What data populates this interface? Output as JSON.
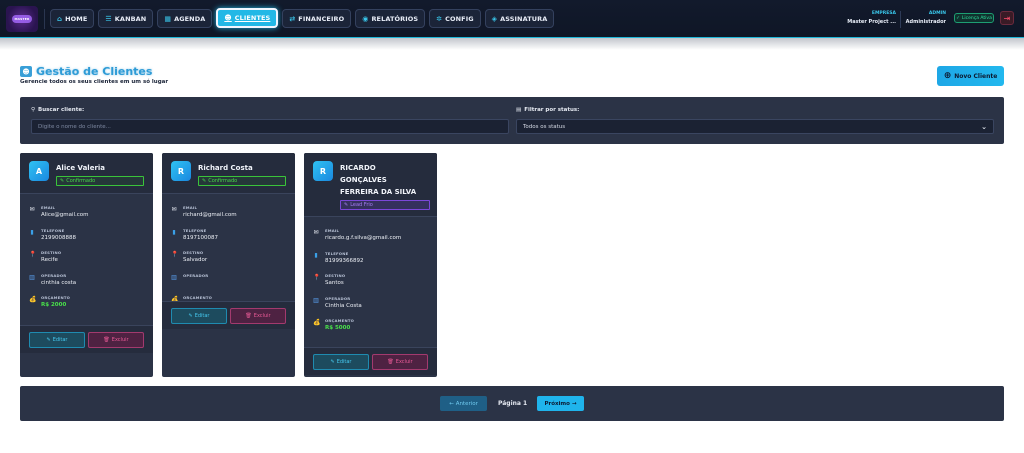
{
  "header": {
    "logo_text": "MASTER",
    "nav": [
      {
        "label": "HOME",
        "icon": "⌂",
        "active": false
      },
      {
        "label": "KANBAN",
        "icon": "☰",
        "active": false
      },
      {
        "label": "AGENDA",
        "icon": "▦",
        "active": false
      },
      {
        "label": "CLIENTES",
        "icon": "☻",
        "active": true
      },
      {
        "label": "FINANCEIRO",
        "icon": "⇄",
        "active": false
      },
      {
        "label": "RELATÓRIOS",
        "icon": "◉",
        "active": false
      },
      {
        "label": "CONFIG",
        "icon": "✲",
        "active": false
      },
      {
        "label": "ASSINATURA",
        "icon": "◈",
        "active": false
      }
    ],
    "empresa_label": "EMPRESA",
    "empresa_value": "Master Project ...",
    "admin_label": "ADMIN",
    "admin_value": "Administrador",
    "licenca_label": "Licença Ativa"
  },
  "page": {
    "title": "Gestão de Clientes",
    "subtitle": "Gerencie todos os seus clientes em um só lugar",
    "new_button": "Novo Cliente"
  },
  "filters": {
    "search_label": "Buscar cliente:",
    "search_placeholder": "Digite o nome do cliente...",
    "status_label": "Filtrar por status:",
    "status_value": "Todos os status"
  },
  "field_labels": {
    "email": "EMAIL",
    "telefone": "TELEFONE",
    "destino": "DESTINO",
    "operador": "OPERADOR",
    "orcamento": "ORÇAMENTO"
  },
  "cards": [
    {
      "initial": "A",
      "name_lines": [
        "Alice Valeria"
      ],
      "status": "Confirmado",
      "status_color": "green",
      "email": "Alice@gmail.com",
      "telefone": "2199008888",
      "destino": "Recife",
      "operador": "cinthia costa",
      "orcamento": "R$ 2000"
    },
    {
      "initial": "R",
      "name_lines": [
        "Richard Costa"
      ],
      "status": "Confirmado",
      "status_color": "green",
      "email": "richard@gmail.com",
      "telefone": "8197100087",
      "destino": "Salvador",
      "operador": "",
      "orcamento": "R$ 3500"
    },
    {
      "initial": "R",
      "name_lines": [
        "RICARDO",
        "GONÇALVES",
        "FERREIRA DA SILVA"
      ],
      "status": "Lead Frio",
      "status_color": "purple",
      "email": "ricardo.g.f.silva@gmail.com",
      "telefone": "81999366892",
      "destino": "Santos",
      "operador": "Cinthia Costa",
      "orcamento": "R$ 5000"
    }
  ],
  "card_actions": {
    "edit": "Editar",
    "delete": "Excluir"
  },
  "pagination": {
    "prev": "Anterior",
    "label": "Página 1",
    "next": "Próximo"
  },
  "colors": {
    "accent": "#22b8e6",
    "panel": "#2b3346",
    "nav_bg": "#121a2c",
    "success": "#49d84a",
    "danger": "#e85a96",
    "purple": "#a77cf5"
  }
}
